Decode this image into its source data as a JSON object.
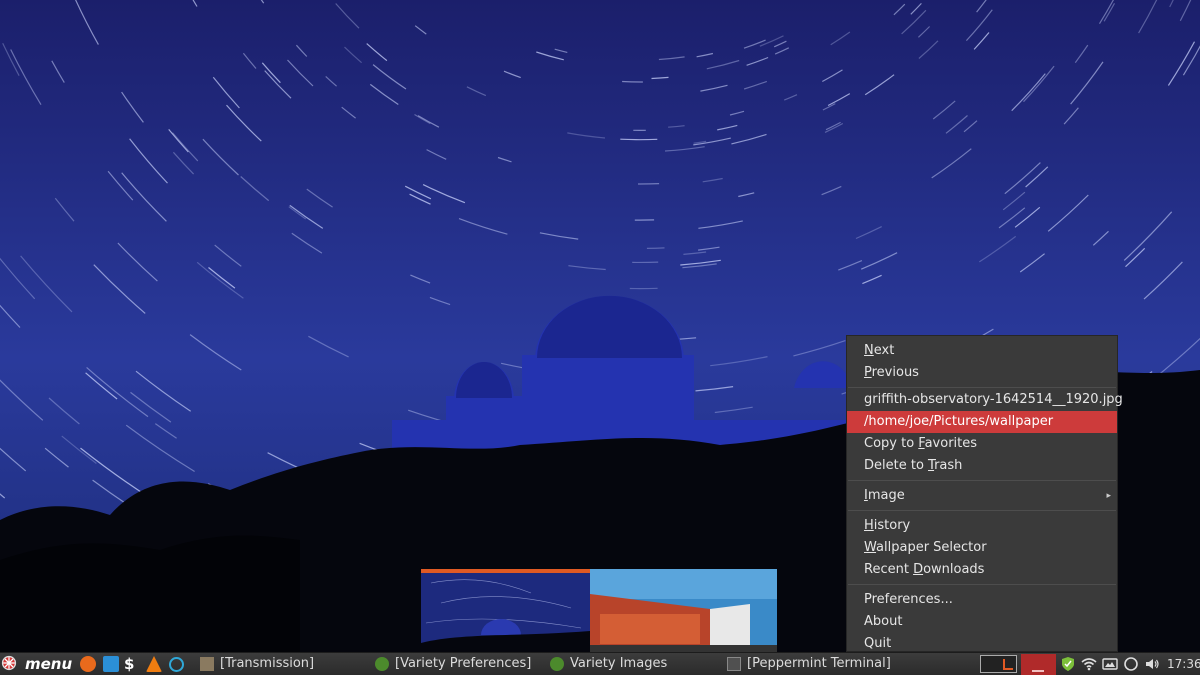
{
  "menu": {
    "items": [
      {
        "label": "Next",
        "mnemonic": "N",
        "rest": "ext"
      },
      {
        "label": "Previous",
        "mnemonic": "P",
        "rest": "revious"
      },
      {
        "label": "griffith-observatory-1642514__1920.jpg"
      },
      {
        "label": "/home/joe/Pictures/wallpaper",
        "highlighted": true
      },
      {
        "label": "Copy to Favorites",
        "pre": "Copy to ",
        "mnemonic": "F",
        "rest": "avorites"
      },
      {
        "label": "Delete to Trash",
        "pre": "Delete to ",
        "mnemonic": "T",
        "rest": "rash"
      },
      {
        "label": "Image",
        "mnemonic": "I",
        "rest": "mage",
        "submenu": true
      },
      {
        "label": "History",
        "mnemonic": "H",
        "rest": "istory"
      },
      {
        "label": "Wallpaper Selector",
        "mnemonic": "W",
        "rest": "allpaper Selector"
      },
      {
        "label": "Recent Downloads",
        "pre": "Recent ",
        "mnemonic": "D",
        "rest": "ownloads"
      },
      {
        "label": "Preferences...",
        "mnemonic": "",
        "rest": "Preferences..."
      },
      {
        "label": "About",
        "mnemonic": "",
        "rest": "About"
      },
      {
        "label": "Quit",
        "mnemonic": "",
        "rest": "Quit"
      }
    ]
  },
  "taskbar": {
    "menu_label": "menu",
    "tasks": [
      {
        "label": "[Transmission]"
      },
      {
        "label": "[Variety Preferences]"
      },
      {
        "label": "Variety Images"
      },
      {
        "label": "[Peppermint Terminal]"
      }
    ],
    "clock": "17:36"
  },
  "colors": {
    "highlight": "#cd3b3b",
    "menu_bg": "#3a3a3a",
    "accent_orange": "#e05a24"
  }
}
